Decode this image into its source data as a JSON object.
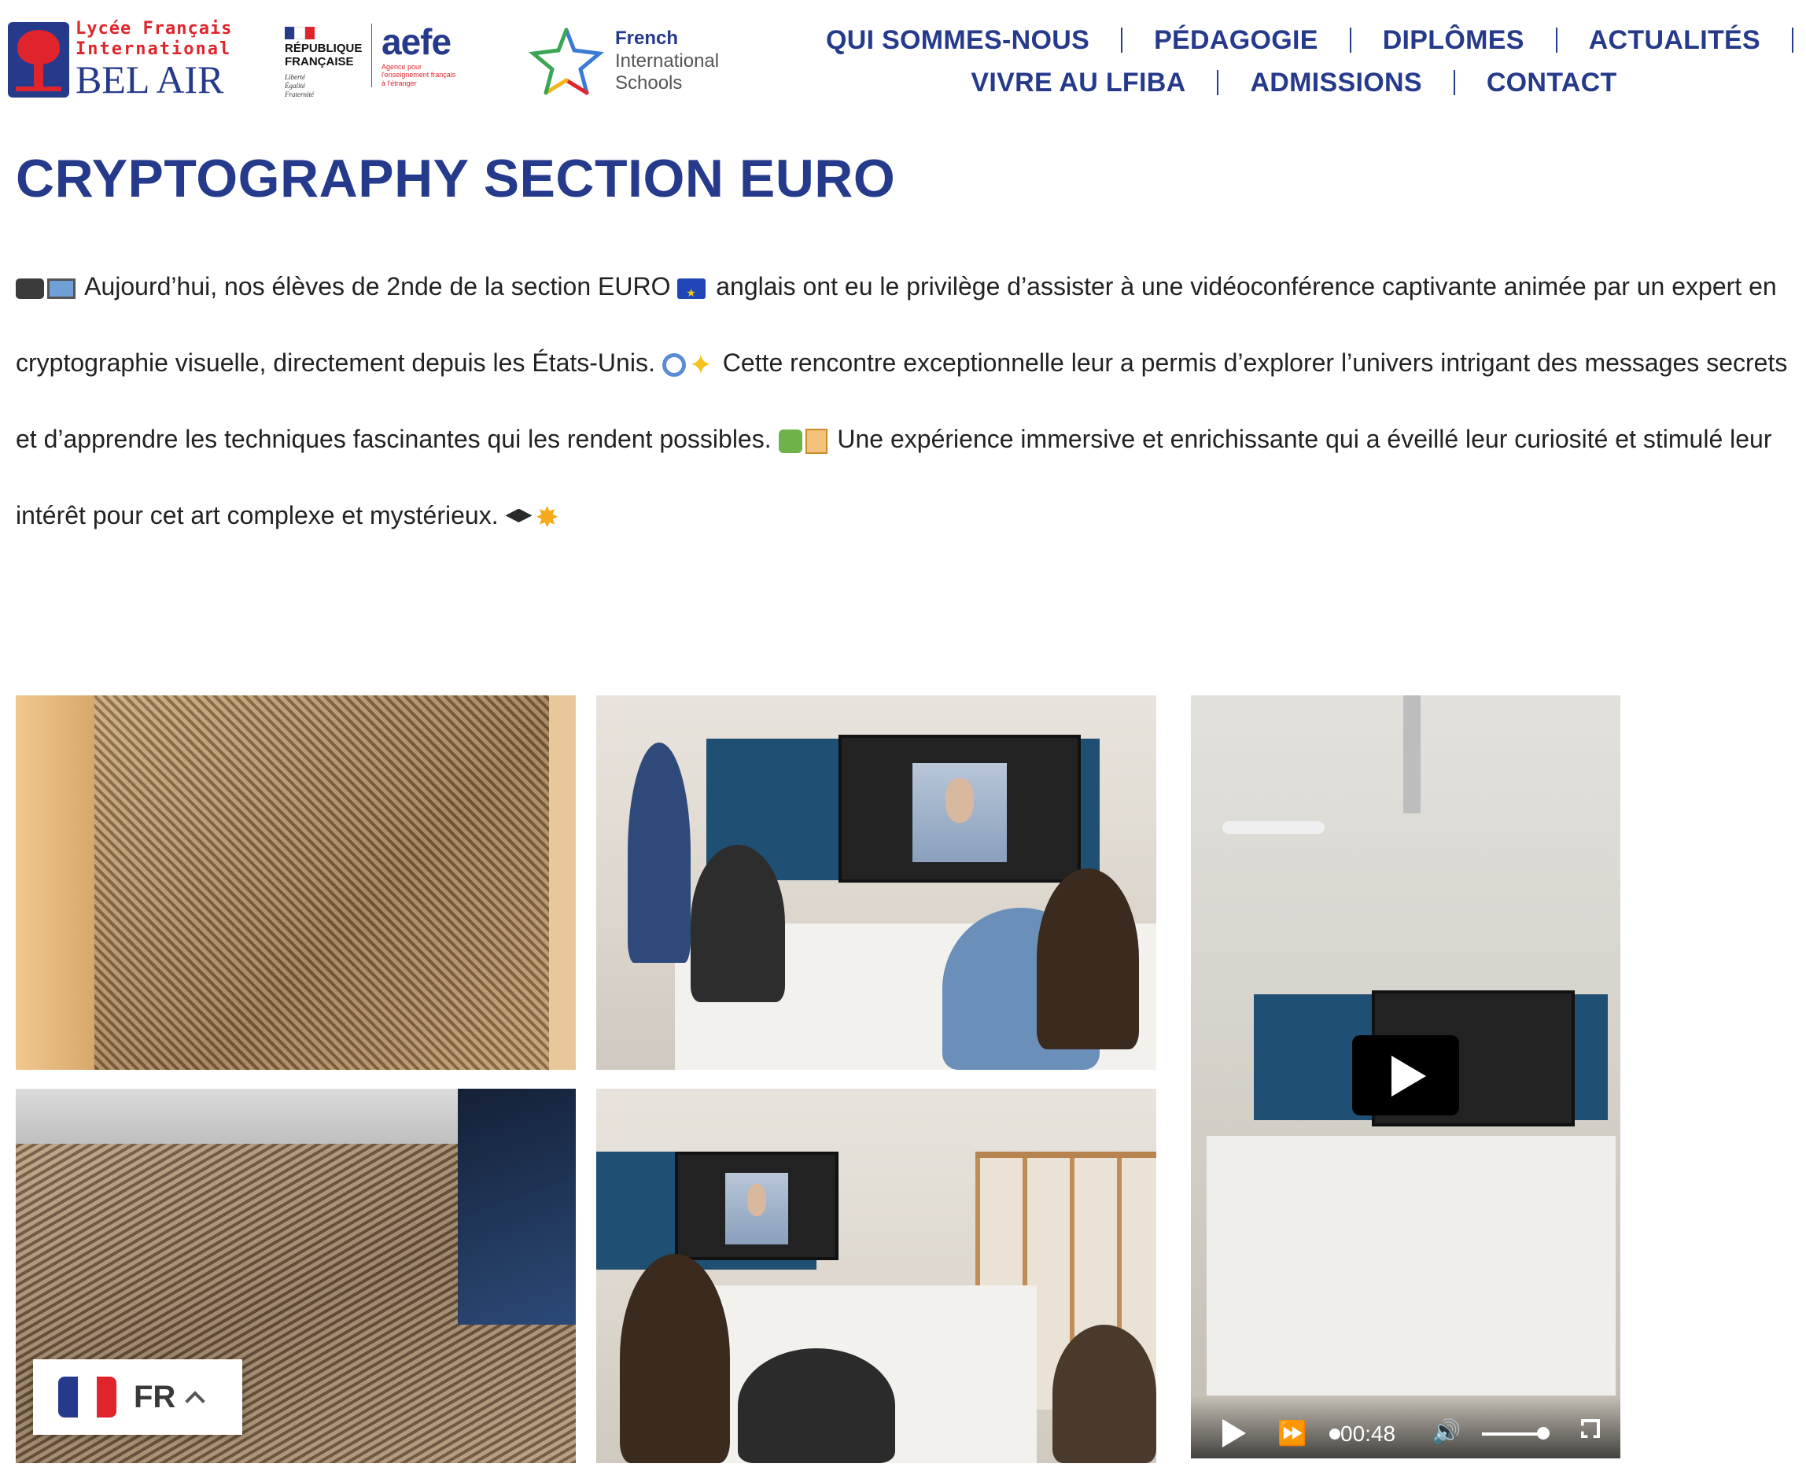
{
  "header": {
    "logo_belair": {
      "line1": "Lycée Français",
      "line2": "International",
      "line3": "BEL AIR"
    },
    "logo_republique": {
      "name_line1": "RÉPUBLIQUE",
      "name_line2": "FRANÇAISE",
      "motto_line1": "Liberté",
      "motto_line2": "Égalité",
      "motto_line3": "Fraternité"
    },
    "logo_aefe": {
      "word": "aefe",
      "sub_line1": "Agence pour",
      "sub_line2": "l'enseignement français",
      "sub_line3": "à l'étranger"
    },
    "logo_fis": {
      "line1": "French",
      "line2": "International",
      "line3": "Schools"
    },
    "nav_row1": [
      "QUI SOMMES-NOUS",
      "PÉDAGOGIE",
      "DIPLÔMES",
      "ACTUALITÉS"
    ],
    "nav_row2": [
      "VIVRE AU LFIBA",
      "ADMISSIONS",
      "CONTACT"
    ]
  },
  "article": {
    "title": "CRYPTOGRAPHY SECTION EURO",
    "p1": "Aujourd’hui, nos élèves de 2nde de la section EURO",
    "p2": "anglais ont eu le privilège d’assister à une vidéoconférence captivante animée par un expert en cryptographie visuelle, directement depuis les États-Unis.",
    "p3": "Cette rencontre exceptionnelle leur a permis d’explorer l’univers intrigant des messages secrets et d’apprendre les techniques fascinantes qui les rendent possibles.",
    "p4": "Une expérience immersive et enrichissante qui a éveillé leur curiosité et stimulé leur intérêt pour cet art complexe et mystérieux.",
    "icons": [
      "video-camera-icon",
      "laptop-icon",
      "eu-flag-icon",
      "magnifier-icon",
      "sparkles-icon",
      "puzzle-icon",
      "scroll-icon",
      "graduation-cap-icon",
      "star-icon"
    ]
  },
  "video": {
    "time": "00:48"
  },
  "language": {
    "code": "FR"
  },
  "colors": {
    "brand_blue": "#263a8c",
    "brand_red": "#e0242c"
  }
}
